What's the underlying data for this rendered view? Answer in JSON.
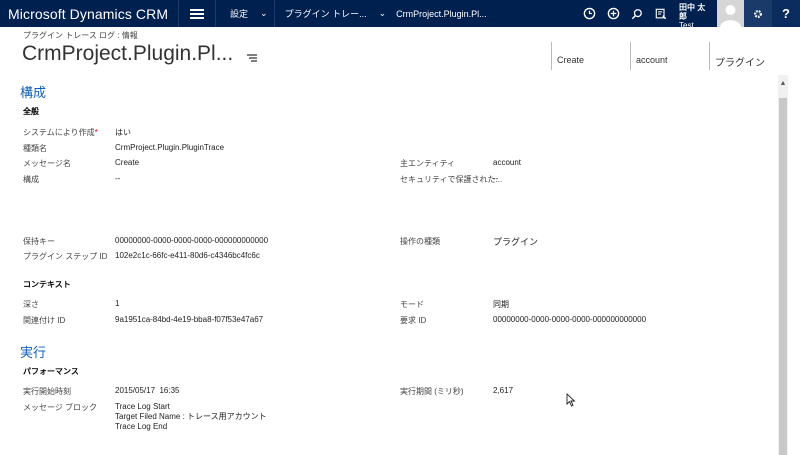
{
  "nav": {
    "brand": "Microsoft Dynamics CRM",
    "crumbs": [
      "設定",
      "プラグイン トレー...",
      "CrmProject.Plugin.Pl..."
    ],
    "user_name": "田中 太郎",
    "user_org": "Test",
    "help": "?"
  },
  "header": {
    "record_type": "プラグイン トレース ログ : 情報",
    "title": "CrmProject.Plugin.Pl...",
    "fields": [
      "Create",
      "account",
      "プラグイン"
    ]
  },
  "sections": {
    "config_title": "構成",
    "general_title": "全般",
    "context_title": "コンテキスト",
    "exec_title": "実行",
    "perf_title": "パフォーマンス"
  },
  "general": {
    "created_by_system_label": "システムにより作成",
    "created_by_system_value": "はい",
    "type_name_label": "種類名",
    "type_name_value": "CrmProject.Plugin.PluginTrace",
    "message_name_label": "メッセージ名",
    "message_name_value": "Create",
    "primary_entity_label": "主エンティティ",
    "primary_entity_value": "account",
    "config_label": "構成",
    "config_value": "--",
    "secure_config_label": "セキュリティで保護された...",
    "secure_config_value": "--",
    "persistence_key_label": "保持キー",
    "persistence_key_value": "00000000-0000-0000-0000-000000000000",
    "operation_type_label": "操作の種類",
    "operation_type_value": "プラグイン",
    "plugin_step_id_label": "プラグイン ステップ ID",
    "plugin_step_id_value": "102e2c1c-66fc-e411-80d6-c4346bc4fc6c"
  },
  "context": {
    "depth_label": "深さ",
    "depth_value": "1",
    "mode_label": "モード",
    "mode_value": "同期",
    "correlation_id_label": "関連付け ID",
    "correlation_id_value": "9a1951ca-84bd-4e19-bba8-f07f53e47a67",
    "request_id_label": "要求 ID",
    "request_id_value": "00000000-0000-0000-0000-000000000000"
  },
  "performance": {
    "start_time_label": "実行開始時刻",
    "start_time_value": "2015/05/17  16:35",
    "duration_label": "実行期間 (ミリ秒)",
    "duration_value": "2,617",
    "message_block_label": "メッセージ ブロック",
    "message_block_lines": [
      "Trace Log Start",
      "Target Filed Name : トレース用アカウント",
      "Trace Log End"
    ]
  },
  "colors": {
    "nav_bg": "#002050",
    "section_title": "#1160b7"
  }
}
